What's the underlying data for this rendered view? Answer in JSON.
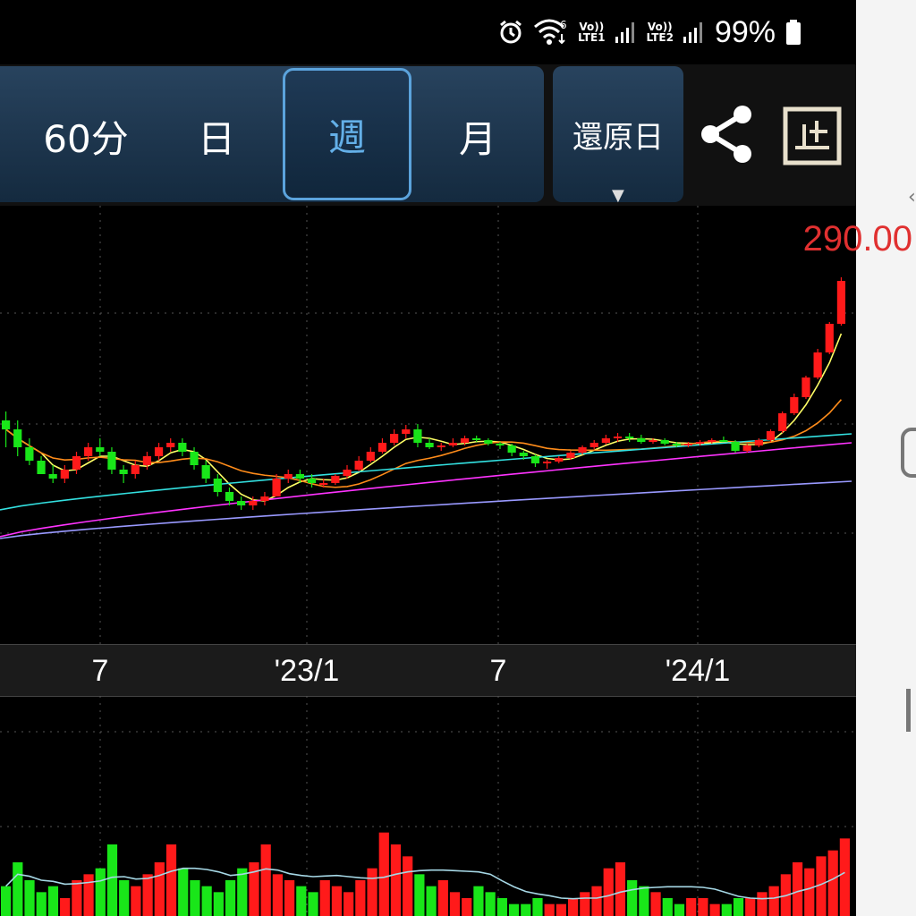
{
  "status_bar": {
    "alarm_icon": "alarm-clock-icon",
    "wifi_icon": "wifi-6-icon",
    "wifi_badge": "6",
    "sim1": {
      "volte": "Vo))",
      "lte": "LTE1"
    },
    "sim2": {
      "volte": "Vo))",
      "lte": "LTE2"
    },
    "battery_percent": "99%"
  },
  "toolbar": {
    "periods": [
      "60分",
      "日",
      "週",
      "月"
    ],
    "active_period": "週",
    "adjust_label": "還原日",
    "share_icon": "share-icon",
    "layout_icon": "layout-toggle-icon"
  },
  "chart_data": [
    {
      "type": "candlestick",
      "price_high_label": "290.00",
      "x_ticks": [
        "7",
        "'23/1",
        "7",
        "'24/1"
      ],
      "colors": {
        "up": "#ff1a1a",
        "down": "#19e619",
        "ma_short": "#ffff66",
        "ma_mid": "#ff8c1a",
        "ma_long1": "#33e0e0",
        "ma_long2": "#ff33ff",
        "ma_long3": "#9999ff"
      },
      "candles": [
        [
          12,
          13,
          9,
          11
        ],
        [
          11,
          12,
          8,
          9
        ],
        [
          9,
          10,
          7,
          7.5
        ],
        [
          7.5,
          8,
          6,
          6
        ],
        [
          6,
          7,
          5,
          5.5
        ],
        [
          5.5,
          7,
          5,
          6.5
        ],
        [
          6.5,
          8.5,
          6,
          8
        ],
        [
          8,
          9.5,
          7.5,
          9
        ],
        [
          9,
          10,
          8,
          8.5
        ],
        [
          8.5,
          9,
          6,
          6.5
        ],
        [
          6.5,
          7,
          5,
          6
        ],
        [
          6,
          7.5,
          5.5,
          7
        ],
        [
          7,
          8.5,
          6.5,
          8
        ],
        [
          8,
          9.5,
          7.5,
          9
        ],
        [
          9,
          10,
          8.5,
          9.5
        ],
        [
          9.5,
          10,
          8,
          8.5
        ],
        [
          8.5,
          9,
          6.5,
          7
        ],
        [
          7,
          7.5,
          5,
          5.5
        ],
        [
          5.5,
          6,
          3.5,
          4
        ],
        [
          4,
          4.5,
          2.5,
          3
        ],
        [
          3,
          3.5,
          2,
          2.5
        ],
        [
          2.5,
          3.5,
          2,
          3
        ],
        [
          3,
          4,
          2.5,
          3.5
        ],
        [
          3.5,
          6,
          3.5,
          5.5
        ],
        [
          5.5,
          6.5,
          5,
          6
        ],
        [
          6,
          6.5,
          5,
          5.5
        ],
        [
          5.5,
          6,
          4.5,
          5
        ],
        [
          5,
          5.5,
          4.5,
          5
        ],
        [
          5,
          6,
          4.8,
          5.8
        ],
        [
          5.8,
          7,
          5.5,
          6.5
        ],
        [
          6.5,
          8,
          6.3,
          7.5
        ],
        [
          7.5,
          9,
          7.3,
          8.5
        ],
        [
          8.5,
          10,
          8.3,
          9.5
        ],
        [
          9.5,
          11,
          9.2,
          10.5
        ],
        [
          10.5,
          11.5,
          10,
          11
        ],
        [
          11,
          11.6,
          9,
          9.5
        ],
        [
          9.5,
          10,
          8.8,
          9
        ],
        [
          9,
          9.5,
          8.6,
          9.2
        ],
        [
          9.2,
          10,
          9,
          9.5
        ],
        [
          9.5,
          10.3,
          9.2,
          10
        ],
        [
          10,
          10.3,
          9.6,
          9.8
        ],
        [
          9.8,
          10,
          9.2,
          9.4
        ],
        [
          9.4,
          9.6,
          8.8,
          9.2
        ],
        [
          9.2,
          9.4,
          8,
          8.4
        ],
        [
          8.4,
          8.6,
          7.6,
          8
        ],
        [
          8,
          8.2,
          6.8,
          7.2
        ],
        [
          7.2,
          7.6,
          6.6,
          7.4
        ],
        [
          7.4,
          8,
          7.2,
          7.8
        ],
        [
          7.8,
          8.6,
          7.6,
          8.4
        ],
        [
          8.4,
          9.2,
          8.2,
          9
        ],
        [
          9,
          9.8,
          8.8,
          9.5
        ],
        [
          9.5,
          10.4,
          9.3,
          10
        ],
        [
          10,
          10.6,
          9.6,
          10.2
        ],
        [
          10.2,
          10.6,
          9.6,
          10
        ],
        [
          10,
          10.4,
          9.4,
          9.6
        ],
        [
          9.6,
          10,
          9.4,
          9.8
        ],
        [
          9.8,
          10,
          9.2,
          9.4
        ],
        [
          9.4,
          9.6,
          9,
          9.2
        ],
        [
          9.2,
          9.6,
          9,
          9.4
        ],
        [
          9.4,
          9.8,
          9.2,
          9.6
        ],
        [
          9.6,
          10,
          9.4,
          9.8
        ],
        [
          9.8,
          10.2,
          9.6,
          9.6
        ],
        [
          9.6,
          9.8,
          8.4,
          8.6
        ],
        [
          8.6,
          9.4,
          8.4,
          9.2
        ],
        [
          9.2,
          10,
          9,
          9.8
        ],
        [
          9.8,
          11,
          9.6,
          10.8
        ],
        [
          10.8,
          13,
          10.6,
          12.8
        ],
        [
          12.8,
          15,
          12.6,
          14.6
        ],
        [
          14.6,
          17,
          14.4,
          16.8
        ],
        [
          16.8,
          20,
          16.6,
          19.6
        ],
        [
          19.6,
          23,
          19.4,
          22.8
        ],
        [
          22.8,
          28,
          22.6,
          27.6
        ]
      ],
      "volume_bars": [
        5,
        9,
        6,
        4,
        5,
        3,
        6,
        7,
        8,
        12,
        6,
        5,
        7,
        9,
        12,
        8,
        6,
        5,
        4,
        6,
        8,
        9,
        12,
        7,
        6,
        5,
        4,
        6,
        5,
        4,
        6,
        8,
        14,
        12,
        10,
        7,
        5,
        6,
        4,
        3,
        5,
        4,
        3,
        2,
        2,
        3,
        2,
        2,
        3,
        4,
        5,
        8,
        9,
        6,
        5,
        4,
        3,
        2,
        3,
        3,
        2,
        2,
        3,
        3,
        4,
        5,
        7,
        9,
        8,
        10,
        11,
        13
      ]
    }
  ]
}
